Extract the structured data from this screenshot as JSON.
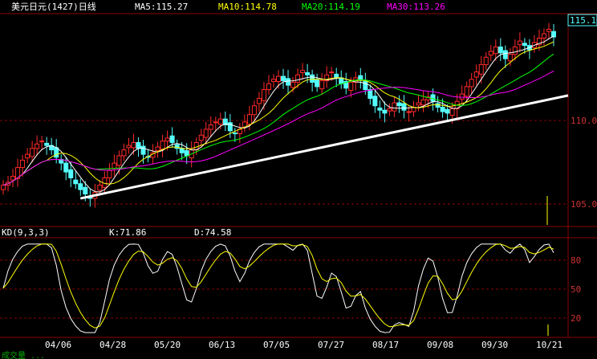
{
  "header": {
    "symbol_title": "美元日元(1427)日线",
    "ma5_label": "MA5:115.27",
    "ma10_label": "MA10:114.78",
    "ma20_label": "MA20:114.19",
    "ma30_label": "MA30:113.26"
  },
  "kd_header": {
    "title": "KD(9,3,3)",
    "k_label": "K:71.86",
    "d_label": "D:74.58"
  },
  "price_panel": {
    "last_price_badge": "115.18",
    "y_ticks": [
      "110.00",
      "105.00"
    ]
  },
  "kd_panel": {
    "y_ticks": [
      "80",
      "50",
      "20"
    ]
  },
  "x_ticks": [
    "04/06",
    "04/28",
    "05/20",
    "06/13",
    "07/05",
    "07/27",
    "08/17",
    "09/08",
    "09/30",
    "10/21"
  ],
  "footer": {
    "text": "成交量 ..."
  },
  "colors": {
    "background": "#000000",
    "up_candle": "#ff2a2a",
    "down_candle": "#54ffff",
    "ma5": "#ffffff",
    "ma10": "#ffff00",
    "ma20": "#00ff00",
    "ma30": "#ff00ff",
    "k_line": "#ffffff",
    "d_line": "#ffff00",
    "grid": "#8b0000",
    "trendline": "#ffffff"
  },
  "chart_data": {
    "type": "candlestick",
    "price_axis": {
      "ticks": [
        110.0,
        105.0
      ],
      "ylim": [
        102.4,
        116.6
      ]
    },
    "kd_axis": {
      "ticks": [
        80,
        50,
        20
      ],
      "ylim": [
        5,
        95
      ]
    },
    "x_tick_labels": [
      "04/06",
      "04/28",
      "05/20",
      "06/13",
      "07/05",
      "07/27",
      "08/17",
      "09/08",
      "09/30",
      "10/21"
    ],
    "close_series": [
      105.1,
      105.3,
      105.7,
      106.3,
      106.8,
      107.2,
      107.6,
      107.9,
      108.1,
      107.8,
      107.5,
      107.0,
      106.6,
      106.0,
      105.6,
      105.2,
      104.8,
      104.5,
      104.2,
      104.6,
      105.1,
      105.6,
      106.1,
      106.6,
      107.1,
      107.5,
      107.8,
      108.0,
      107.6,
      107.2,
      107.0,
      107.3,
      107.7,
      108.1,
      108.3,
      108.0,
      107.6,
      107.3,
      107.1,
      107.5,
      108.0,
      108.5,
      108.9,
      109.2,
      109.4,
      109.6,
      109.2,
      108.8,
      108.6,
      108.9,
      109.4,
      109.9,
      110.5,
      111.0,
      111.6,
      112.0,
      112.3,
      112.5,
      112.2,
      111.9,
      112.1,
      112.6,
      112.9,
      112.6,
      112.1,
      111.8,
      112.2,
      112.6,
      112.8,
      112.4,
      112.0,
      111.7,
      112.1,
      112.4,
      112.3,
      111.6,
      111.0,
      110.5,
      110.2,
      110.0,
      110.3,
      110.7,
      110.5,
      110.2,
      110.1,
      110.4,
      110.7,
      110.9,
      111.1,
      110.8,
      110.4,
      110.1,
      110.0,
      110.3,
      110.8,
      111.3,
      111.8,
      112.3,
      112.8,
      113.3,
      113.8,
      114.2,
      114.5,
      114.1,
      113.7,
      114.0,
      114.5,
      114.9,
      114.6,
      114.3,
      114.8,
      115.1,
      115.4,
      115.7,
      115.18
    ],
    "ma5_last": 115.27,
    "ma10_last": 114.78,
    "ma20_last": 114.19,
    "ma30_last": 113.26,
    "k_last": 71.86,
    "d_last": 74.58,
    "trendline": {
      "start": {
        "x_label": "04/28",
        "price": 104.2
      },
      "end": {
        "x_label": "10/21",
        "price": 111.2
      }
    }
  }
}
